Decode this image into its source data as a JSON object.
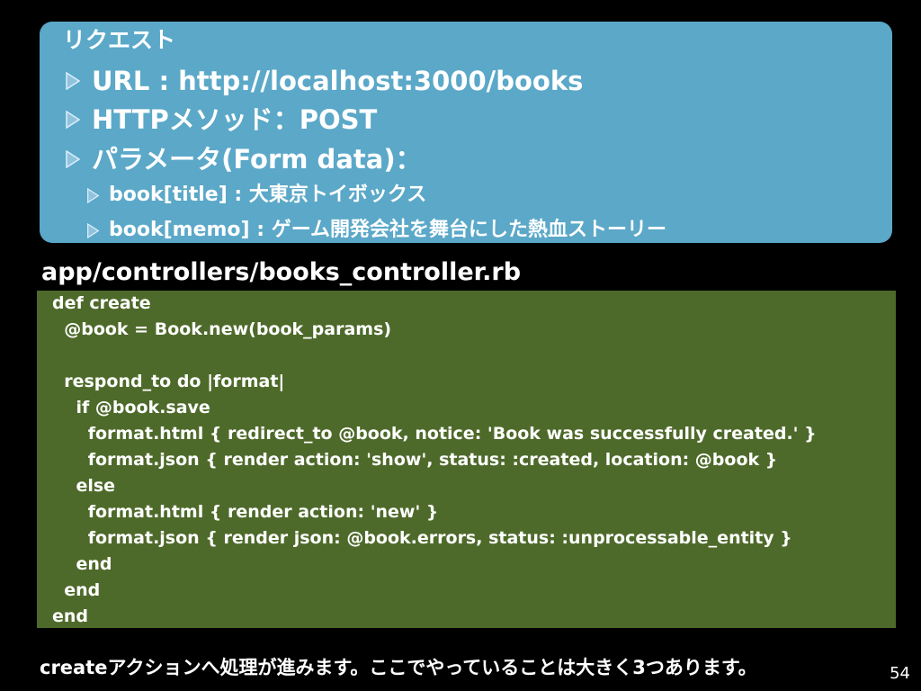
{
  "request": {
    "title": "リクエスト",
    "url": "URL : http://localhost:3000/books",
    "method": "HTTPメソッド：POST",
    "params_label": "パラメータ(Form data)：",
    "param_title": "book[title] : 大東京トイボックス",
    "param_memo": "book[memo] : ゲーム開発会社を舞台にした熱血ストーリー"
  },
  "file_path": "app/controllers/books_controller.rb",
  "code": {
    "lines": [
      "def create",
      "  @book = Book.new(book_params)",
      "",
      "  respond_to do |format|",
      "    if @book.save",
      "      format.html { redirect_to @book, notice: 'Book was successfully created.' }",
      "      format.json { render action: 'show', status: :created, location: @book }",
      "    else",
      "      format.html { render action: 'new' }",
      "      format.json { render json: @book.errors, status: :unprocessable_entity }",
      "    end",
      "  end",
      "end"
    ]
  },
  "footer": "createアクションへ処理が進みます。ここでやっていることは大きく3つあります。",
  "page_number": "54",
  "colors": {
    "background": "#000000",
    "request_box": "#5ba8c8",
    "code_box": "#4e6a2a",
    "text": "#ffffff",
    "bullet": "#8fc3dc"
  },
  "icons": {
    "bullet": "triangle-bullet-icon"
  }
}
